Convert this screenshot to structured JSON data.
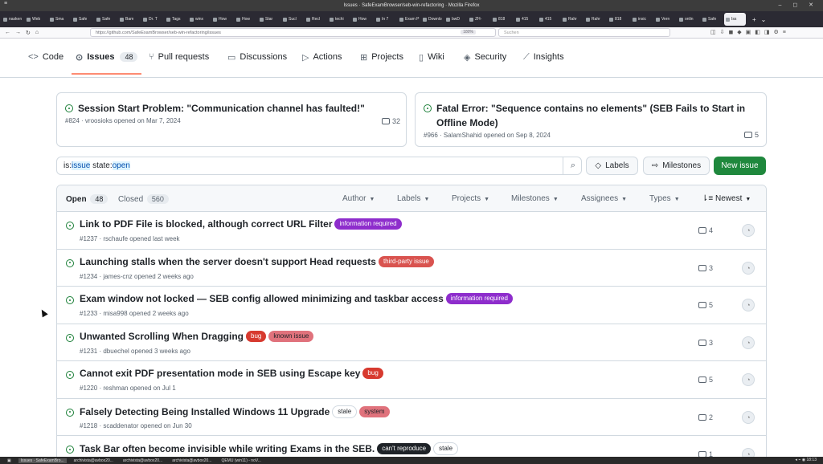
{
  "window": {
    "title": "Issues · SafeExamBrowser/seb-win-refactoring · Mozilla Firefox",
    "controls": "– ◻ ✕"
  },
  "browser": {
    "tabs": [
      "nasken",
      "Web",
      "Sma",
      "Safe",
      "Safe",
      "Bam",
      "Dr. T",
      "Tags",
      "winx",
      "How",
      "How",
      "Star",
      "Sucl",
      "Recl",
      "techi",
      "How",
      "In 7",
      "Exam P",
      "Downlo",
      "bwD",
      "ZH-",
      "818",
      "415",
      "415",
      "Rahr",
      "Rahr",
      "818",
      "insic",
      "Vern",
      "onlin",
      "Safe",
      "Iss"
    ],
    "url": "https://github.com/SafeExamBrowser/seb-win-refactoring/issues",
    "zoom": "180%",
    "search_placeholder": "Suchen"
  },
  "repo_nav": {
    "code": "Code",
    "issues": "Issues",
    "issues_count": "48",
    "pull_requests": "Pull requests",
    "discussions": "Discussions",
    "actions": "Actions",
    "projects": "Projects",
    "wiki": "Wiki",
    "security": "Security",
    "insights": "Insights"
  },
  "pinned": [
    {
      "title": "Session Start Problem: \"Communication channel has faulted!\"",
      "meta": "#824 · vroosioks opened on Mar 7, 2024",
      "comments": "32"
    },
    {
      "title": "Fatal Error: \"Sequence contains no elements\" (SEB Fails to Start in Offline Mode)",
      "meta": "#966 · SalamShahid opened on Sep 8, 2024",
      "comments": "5"
    }
  ],
  "filter": {
    "query_prefix": "is:",
    "query_issue": "issue",
    "query_state": " state:",
    "query_open": "open",
    "labels": "Labels",
    "milestones": "Milestones",
    "new_issue": "New issue"
  },
  "list_header": {
    "open": "Open",
    "open_count": "48",
    "closed": "Closed",
    "closed_count": "560",
    "author": "Author",
    "labels": "Labels",
    "projects": "Projects",
    "milestones": "Milestones",
    "assignees": "Assignees",
    "types": "Types",
    "sort": "Newest"
  },
  "issues": [
    {
      "title": "Link to PDF File is blocked, although correct URL Filter",
      "meta": "#1237 · rschaufe opened last week",
      "comments": "4",
      "labels": [
        {
          "text": "information required",
          "bg": "#8e2dcc",
          "fg": "#ffffff"
        }
      ]
    },
    {
      "title": "Launching stalls when the server doesn't support Head requests",
      "meta": "#1234 · james-cnz opened 2 weeks ago",
      "comments": "3",
      "labels": [
        {
          "text": "third-party issue",
          "bg": "#d9534f",
          "fg": "#ffffff"
        }
      ]
    },
    {
      "title": "Exam window not locked — SEB config allowed minimizing and taskbar access",
      "meta": "#1233 · misa998 opened 2 weeks ago",
      "comments": "5",
      "labels": [
        {
          "text": "information required",
          "bg": "#8e2dcc",
          "fg": "#ffffff"
        }
      ]
    },
    {
      "title": "Unwanted Scrolling When Dragging",
      "meta": "#1231 · dbuechel opened 3 weeks ago",
      "comments": "3",
      "labels": [
        {
          "text": "bug",
          "bg": "#d73a2f",
          "fg": "#ffffff"
        },
        {
          "text": "known issue",
          "bg": "#e0727c",
          "fg": "#1f2328"
        }
      ]
    },
    {
      "title": "Cannot exit PDF presentation mode in SEB using Escape key",
      "meta": "#1220 · reshman opened on Jul 1",
      "comments": "5",
      "labels": [
        {
          "text": "bug",
          "bg": "#d73a2f",
          "fg": "#ffffff"
        }
      ]
    },
    {
      "title": "Falsely Detecting Being Installed Windows 11 Upgrade",
      "meta": "#1218 · scaddenator opened on Jun 30",
      "comments": "2",
      "labels": [
        {
          "text": "stale",
          "bg": "#ffffff",
          "fg": "#1f2328",
          "border": "#d1d9e0"
        },
        {
          "text": "system",
          "bg": "#e0727c",
          "fg": "#1f2328"
        }
      ]
    },
    {
      "title": "Task Bar often become invisible while writing Exams in the SEB.",
      "meta": "",
      "comments": "1",
      "labels": [
        {
          "text": "can't reproduce",
          "bg": "#1f2328",
          "fg": "#ffffff"
        },
        {
          "text": "stale",
          "bg": "#ffffff",
          "fg": "#1f2328",
          "border": "#d1d9e0"
        }
      ]
    }
  ],
  "taskbar": {
    "items": [
      "Issues · SafeExamBro...",
      "archivista@avbox20...",
      "archivista@avbox20...",
      "archivista@avbox20...",
      "QEMU (win11) - noV..."
    ],
    "clock": "18:13"
  }
}
